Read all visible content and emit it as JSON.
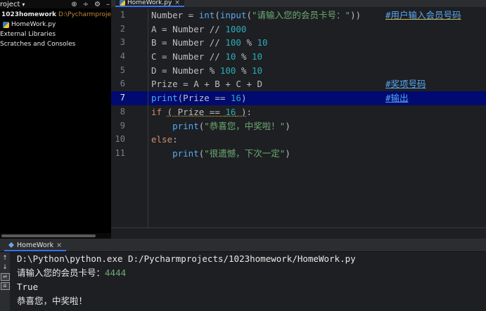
{
  "project_panel": {
    "header_title": "roject",
    "header_dropdown": "▾",
    "header_icons": [
      "⊕",
      "÷",
      "⚙",
      "–"
    ],
    "rows": [
      {
        "label": "1023homework",
        "path": "D:\\Pycharmprojects\\"
      },
      {
        "label": "HomeWork.py"
      },
      {
        "label": "External Libraries"
      },
      {
        "label": "Scratches and Consoles"
      }
    ]
  },
  "editor": {
    "tab_label": "HomeWork.py",
    "tab_close": "×",
    "active_line": 7,
    "line_numbers": [
      "1",
      "2",
      "3",
      "4",
      "5",
      "6",
      "7",
      "8",
      "9",
      "10",
      "11"
    ],
    "code": {
      "l1": {
        "a": "Number = ",
        "b": "int",
        "c": "(",
        "d": "input",
        "e": "(",
        "f": "\"请输入您的会员卡号：\"",
        "g": "))",
        "comment": "#用户输入会员号码"
      },
      "l2": {
        "a": "A = Number // ",
        "n1": "1000"
      },
      "l3": {
        "a": "B = Number // ",
        "n1": "100",
        "op": " % ",
        "n2": "10"
      },
      "l4": {
        "a": "C = Number // ",
        "n1": "10",
        "op": " % ",
        "n2": "10"
      },
      "l5": {
        "a": "D = Number % ",
        "n1": "100",
        "op": " % ",
        "n2": "10"
      },
      "l6": {
        "a": "Prize = A + B + C + D",
        "comment": "#奖项号码"
      },
      "l7": {
        "a": "print",
        "b": "(Prize == ",
        "n1": "16",
        "c": ")",
        "comment": "#输出"
      },
      "l8": {
        "kw": "if",
        "sp": " ",
        "u": "( Prize == ",
        "n1": "16",
        "u2": " )",
        "c": ":"
      },
      "l9": {
        "indent": "    ",
        "a": "print",
        "b": "(",
        "s": "\"恭喜您，中奖啦！\"",
        "c": ")"
      },
      "l10": {
        "kw": "else",
        "c": ":"
      },
      "l11": {
        "indent": "    ",
        "a": "print",
        "b": "(",
        "s": "\"很遗憾，下次一定\"",
        "c": ")"
      }
    }
  },
  "run_panel": {
    "tab_label": "HomeWork",
    "tab_close": "×",
    "sidebar_icons": [
      "↑",
      "↓",
      "⇌",
      "⇊"
    ],
    "console_lines": {
      "cmd": "D:\\Python\\python.exe D:/Pycharmprojects/1023homework/HomeWork.py",
      "prompt": "请输入您的会员卡号：",
      "input": "4444",
      "result": "True",
      "output": "恭喜您，中奖啦！"
    }
  },
  "colors": {
    "keyword": "#cf8e6d",
    "function": "#56a8f5",
    "number": "#2aacb8",
    "string": "#6aab73",
    "active_line_bg": "#000a70"
  }
}
